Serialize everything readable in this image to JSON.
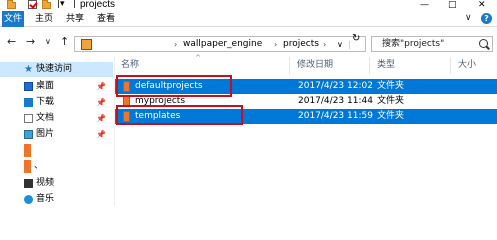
{
  "window": {
    "title": "projects",
    "controls": {
      "minimize": "—",
      "maximize": "□",
      "close": "✕"
    }
  },
  "ribbon": {
    "tabs": [
      "文件",
      "主页",
      "共享",
      "查看"
    ],
    "expand": "∨",
    "help": "?"
  },
  "nav": {
    "back": "←",
    "forward": "→",
    "recent": "∨",
    "up": "↑",
    "breadcrumbs": [
      "wallpaper_engine",
      "projects"
    ],
    "separator": "›",
    "dropdown": "∨",
    "refresh": "↻"
  },
  "search": {
    "placeholder": "搜索\"projects\""
  },
  "sidebar": {
    "items": [
      {
        "label": "快速访问",
        "icon": "star-icon"
      },
      {
        "label": "桌面",
        "icon": "desktop-icon",
        "pin": "📌"
      },
      {
        "label": "下载",
        "icon": "download-icon",
        "pin": "📌"
      },
      {
        "label": "文档",
        "icon": "document-icon",
        "pin": "📌"
      },
      {
        "label": "图片",
        "icon": "pictures-icon",
        "pin": "📌"
      },
      {
        "label": "",
        "icon": "folder-icon"
      },
      {
        "label": "、",
        "icon": "folder-icon"
      },
      {
        "label": "视频",
        "icon": "video-icon"
      },
      {
        "label": "音乐",
        "icon": "music-icon"
      }
    ]
  },
  "file_list": {
    "columns": [
      "名称",
      "修改日期",
      "类型",
      "大小"
    ],
    "sort_caret": "^",
    "rows": [
      {
        "name": "defaultprojects",
        "modified": "2017/4/23 12:02",
        "type": "文件夹",
        "size": "",
        "selected": true,
        "highlighted": true
      },
      {
        "name": "myprojects",
        "modified": "2017/4/23 11:44",
        "type": "文件夹",
        "size": "",
        "selected": false,
        "highlighted": false
      },
      {
        "name": "templates",
        "modified": "2017/4/23 11:59",
        "type": "文件夹",
        "size": "",
        "selected": true,
        "highlighted": true
      }
    ]
  },
  "colors": {
    "accent": "#0078d7",
    "selection_light": "#cce8ff",
    "highlight_box": "#c8101c",
    "folder": "#f0742a"
  }
}
